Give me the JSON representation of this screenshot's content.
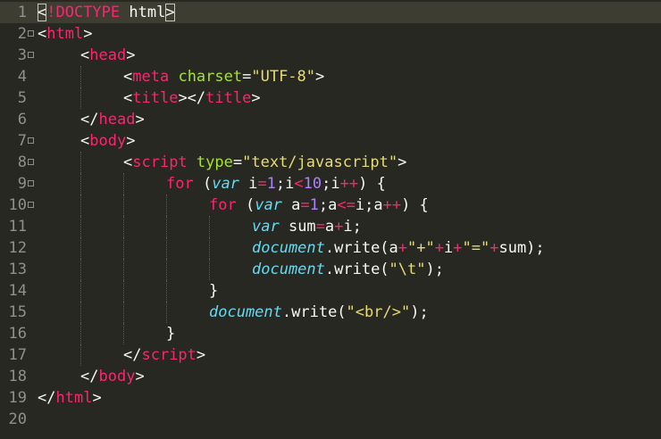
{
  "editor": {
    "theme_colors": {
      "background": "#272822",
      "text": "#f8f8f2",
      "tag": "#f92672",
      "attribute": "#a6e22e",
      "string": "#e6db74",
      "number": "#ae81ff",
      "storage": "#66d9ef",
      "gutter": "#90908a"
    },
    "lines": [
      {
        "n": "1",
        "fold": false,
        "indent": 0,
        "tokens": [
          {
            "c": "t-p",
            "t": "<"
          },
          {
            "c": "t-doctype",
            "t": "!DOCTYPE"
          },
          {
            "c": "t-p",
            "t": " html"
          },
          {
            "c": "t-p",
            "t": ">"
          }
        ]
      },
      {
        "n": "2",
        "fold": true,
        "indent": 0,
        "tokens": [
          {
            "c": "t-p",
            "t": "<"
          },
          {
            "c": "t-tag",
            "t": "html"
          },
          {
            "c": "t-p",
            "t": ">"
          }
        ]
      },
      {
        "n": "3",
        "fold": true,
        "indent": 1,
        "tokens": [
          {
            "c": "t-p",
            "t": "<"
          },
          {
            "c": "t-tag",
            "t": "head"
          },
          {
            "c": "t-p",
            "t": ">"
          }
        ]
      },
      {
        "n": "4",
        "fold": false,
        "indent": 2,
        "tokens": [
          {
            "c": "t-p",
            "t": "<"
          },
          {
            "c": "t-tag",
            "t": "meta"
          },
          {
            "c": "t-p",
            "t": " "
          },
          {
            "c": "t-attr",
            "t": "charset"
          },
          {
            "c": "t-p",
            "t": "="
          },
          {
            "c": "t-str",
            "t": "\"UTF-8\""
          },
          {
            "c": "t-p",
            "t": ">"
          }
        ]
      },
      {
        "n": "5",
        "fold": false,
        "indent": 2,
        "tokens": [
          {
            "c": "t-p",
            "t": "<"
          },
          {
            "c": "t-tag",
            "t": "title"
          },
          {
            "c": "t-p",
            "t": "></"
          },
          {
            "c": "t-tag",
            "t": "title"
          },
          {
            "c": "t-p",
            "t": ">"
          }
        ]
      },
      {
        "n": "6",
        "fold": false,
        "indent": 1,
        "tokens": [
          {
            "c": "t-p",
            "t": "</"
          },
          {
            "c": "t-tag",
            "t": "head"
          },
          {
            "c": "t-p",
            "t": ">"
          }
        ]
      },
      {
        "n": "7",
        "fold": true,
        "indent": 1,
        "tokens": [
          {
            "c": "t-p",
            "t": "<"
          },
          {
            "c": "t-tag",
            "t": "body"
          },
          {
            "c": "t-p",
            "t": ">"
          }
        ]
      },
      {
        "n": "8",
        "fold": true,
        "indent": 2,
        "tokens": [
          {
            "c": "t-p",
            "t": "<"
          },
          {
            "c": "t-tag",
            "t": "script"
          },
          {
            "c": "t-p",
            "t": " "
          },
          {
            "c": "t-attr",
            "t": "type"
          },
          {
            "c": "t-p",
            "t": "="
          },
          {
            "c": "t-str",
            "t": "\"text/javascript\""
          },
          {
            "c": "t-p",
            "t": ">"
          }
        ]
      },
      {
        "n": "9",
        "fold": true,
        "indent": 3,
        "tokens": [
          {
            "c": "t-kw",
            "t": "for"
          },
          {
            "c": "t-p",
            "t": " ("
          },
          {
            "c": "t-st",
            "t": "var"
          },
          {
            "c": "t-p",
            "t": " i"
          },
          {
            "c": "t-op",
            "t": "="
          },
          {
            "c": "t-num",
            "t": "1"
          },
          {
            "c": "t-p",
            "t": ";i"
          },
          {
            "c": "t-op",
            "t": "<"
          },
          {
            "c": "t-num",
            "t": "10"
          },
          {
            "c": "t-p",
            "t": ";i"
          },
          {
            "c": "t-op",
            "t": "++"
          },
          {
            "c": "t-p",
            "t": ") {"
          }
        ]
      },
      {
        "n": "10",
        "fold": true,
        "indent": 4,
        "tokens": [
          {
            "c": "t-kw",
            "t": "for"
          },
          {
            "c": "t-p",
            "t": " ("
          },
          {
            "c": "t-st",
            "t": "var"
          },
          {
            "c": "t-p",
            "t": " a"
          },
          {
            "c": "t-op",
            "t": "="
          },
          {
            "c": "t-num",
            "t": "1"
          },
          {
            "c": "t-p",
            "t": ";a"
          },
          {
            "c": "t-op",
            "t": "<="
          },
          {
            "c": "t-p",
            "t": "i;a"
          },
          {
            "c": "t-op",
            "t": "++"
          },
          {
            "c": "t-p",
            "t": ") {"
          }
        ]
      },
      {
        "n": "11",
        "fold": false,
        "indent": 5,
        "tokens": [
          {
            "c": "t-st",
            "t": "var"
          },
          {
            "c": "t-p",
            "t": " sum"
          },
          {
            "c": "t-op",
            "t": "="
          },
          {
            "c": "t-p",
            "t": "a"
          },
          {
            "c": "t-op",
            "t": "+"
          },
          {
            "c": "t-p",
            "t": "i;"
          }
        ]
      },
      {
        "n": "12",
        "fold": false,
        "indent": 5,
        "tokens": [
          {
            "c": "t-st",
            "t": "document"
          },
          {
            "c": "t-p",
            "t": ".write(a"
          },
          {
            "c": "t-op",
            "t": "+"
          },
          {
            "c": "t-str",
            "t": "\"+\""
          },
          {
            "c": "t-op",
            "t": "+"
          },
          {
            "c": "t-p",
            "t": "i"
          },
          {
            "c": "t-op",
            "t": "+"
          },
          {
            "c": "t-str",
            "t": "\"=\""
          },
          {
            "c": "t-op",
            "t": "+"
          },
          {
            "c": "t-p",
            "t": "sum);"
          }
        ]
      },
      {
        "n": "13",
        "fold": false,
        "indent": 5,
        "tokens": [
          {
            "c": "t-st",
            "t": "document"
          },
          {
            "c": "t-p",
            "t": ".write("
          },
          {
            "c": "t-str",
            "t": "\"\\t\""
          },
          {
            "c": "t-p",
            "t": ");"
          }
        ]
      },
      {
        "n": "14",
        "fold": false,
        "indent": 4,
        "tokens": [
          {
            "c": "t-p",
            "t": "}"
          }
        ]
      },
      {
        "n": "15",
        "fold": false,
        "indent": 4,
        "tokens": [
          {
            "c": "t-st",
            "t": "document"
          },
          {
            "c": "t-p",
            "t": ".write("
          },
          {
            "c": "t-str",
            "t": "\"<br/>\""
          },
          {
            "c": "t-p",
            "t": ");"
          }
        ]
      },
      {
        "n": "16",
        "fold": false,
        "indent": 3,
        "tokens": [
          {
            "c": "t-p",
            "t": "}"
          }
        ]
      },
      {
        "n": "17",
        "fold": false,
        "indent": 2,
        "tokens": [
          {
            "c": "t-p",
            "t": "</"
          },
          {
            "c": "t-tag",
            "t": "script"
          },
          {
            "c": "t-p",
            "t": ">"
          }
        ]
      },
      {
        "n": "18",
        "fold": false,
        "indent": 1,
        "tokens": [
          {
            "c": "t-p",
            "t": "</"
          },
          {
            "c": "t-tag",
            "t": "body"
          },
          {
            "c": "t-p",
            "t": ">"
          }
        ]
      },
      {
        "n": "19",
        "fold": false,
        "indent": 0,
        "tokens": [
          {
            "c": "t-p",
            "t": "</"
          },
          {
            "c": "t-tag",
            "t": "html"
          },
          {
            "c": "t-p",
            "t": ">"
          }
        ]
      },
      {
        "n": "20",
        "fold": false,
        "indent": 0,
        "tokens": []
      }
    ]
  }
}
